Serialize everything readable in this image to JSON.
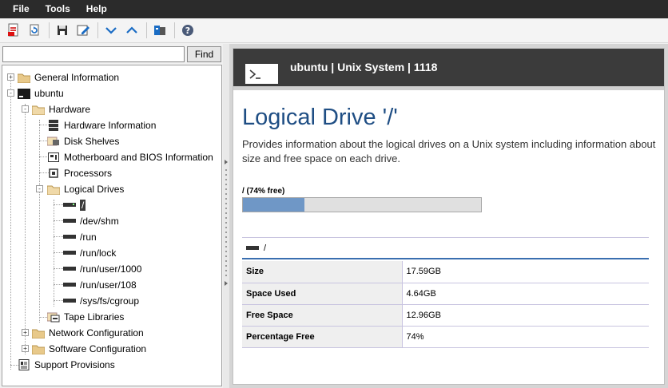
{
  "menu": [
    "File",
    "Tools",
    "Help"
  ],
  "toolbar": {
    "buttons": [
      "export-pdf-icon",
      "refresh-icon",
      "save-icon",
      "edit-icon",
      "collapse-down-icon",
      "collapse-up-icon",
      "database-icon",
      "help-icon"
    ]
  },
  "search": {
    "value": "",
    "placeholder": "",
    "find_label": "Find"
  },
  "tree": {
    "general_info": "General Information",
    "ubuntu": "ubuntu",
    "hardware": "Hardware",
    "hardware_info": "Hardware Information",
    "disk_shelves": "Disk Shelves",
    "motherboard": "Motherboard and BIOS Information",
    "processors": "Processors",
    "logical_drives": "Logical Drives",
    "drives": [
      "/",
      "/dev/shm",
      "/run",
      "/run/lock",
      "/run/user/1000",
      "/run/user/108",
      "/sys/fs/cgroup"
    ],
    "tape_libraries": "Tape Libraries",
    "network_config": "Network Configuration",
    "software_config": "Software Configuration",
    "support_provisions": "Support Provisions"
  },
  "header": {
    "title": "ubuntu | Unix System | 1118"
  },
  "page": {
    "title": "Logical Drive '/'",
    "description": "Provides information about the logical drives on a Unix system including information about size and free space on each drive."
  },
  "usage": {
    "label": "/ (74% free)",
    "used_fraction": 0.26
  },
  "drive": {
    "name": "/",
    "properties": [
      {
        "key": "Size",
        "value": "17.59GB"
      },
      {
        "key": "Space Used",
        "value": "4.64GB"
      },
      {
        "key": "Free Space",
        "value": "12.96GB"
      },
      {
        "key": "Percentage Free",
        "value": "74%"
      }
    ]
  },
  "colors": {
    "accent": "#1f4e84",
    "header_bg": "#3b3b3b",
    "bar_fill": "#6f97c6",
    "selection": "#3c3c3c"
  }
}
